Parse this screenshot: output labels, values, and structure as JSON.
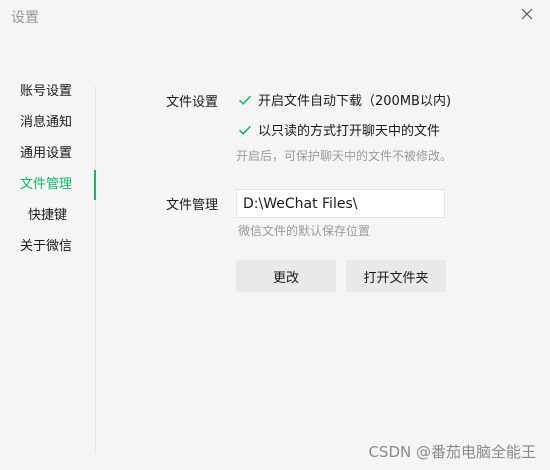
{
  "window": {
    "title": "设置"
  },
  "sidebar": {
    "items": [
      {
        "label": "账号设置"
      },
      {
        "label": "消息通知"
      },
      {
        "label": "通用设置"
      },
      {
        "label": "文件管理"
      },
      {
        "label": "快捷键"
      },
      {
        "label": "关于微信"
      }
    ],
    "active_index": 3
  },
  "file_settings": {
    "label": "文件设置",
    "options": [
      {
        "label": "开启文件自动下载（200MB以内)",
        "checked": true
      },
      {
        "label": "以只读的方式打开聊天中的文件",
        "checked": true
      }
    ],
    "hint": "开启后，可保护聊天中的文件不被修改。"
  },
  "file_management": {
    "label": "文件管理",
    "path_value": "D:\\WeChat Files\\",
    "hint": "微信文件的默认保存位置",
    "change_button": "更改",
    "open_folder_button": "打开文件夹"
  },
  "watermark": "CSDN @番茄电脑全能王",
  "colors": {
    "accent": "#07c160",
    "background": "#f5f5f5",
    "hint_text": "#9a9a9a",
    "button_bg": "#e9e9e9"
  },
  "icons": {
    "close": "close-icon",
    "check": "checkmark-icon"
  }
}
